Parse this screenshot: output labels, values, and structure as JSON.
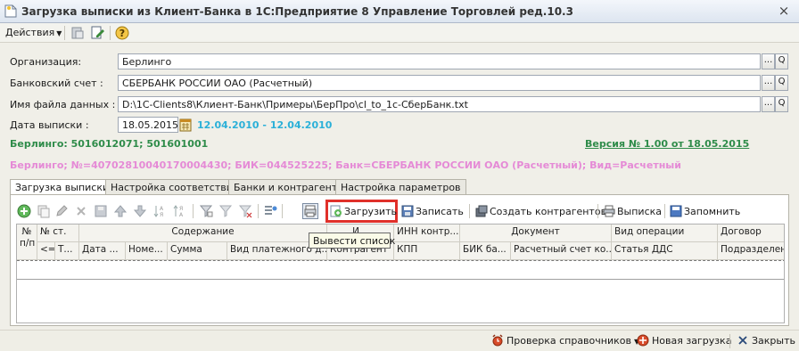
{
  "window": {
    "title": "Загрузка выписки из Клиент-Банка в 1С:Предприятие 8 Управление Торговлей ред.10.3",
    "close": "×"
  },
  "toolbar": {
    "actions_label": "Действия",
    "help_label": "?"
  },
  "form": {
    "org_label": "Организация:",
    "org_value": "Берлинго",
    "account_label": "Банковский счет :",
    "account_value": "СБЕРБАНК РОССИИ ОАО (Расчетный)",
    "file_label": "Имя файла данных :",
    "file_value": "D:\\1С-Clients8\\Клиент-Банк\\Примеры\\БерПро\\cl_to_1c-СберБанк.txt",
    "date_label": "Дата выписки :",
    "date_value": "18.05.2015",
    "period": "12.04.2010 - 12.04.2010",
    "org_codes": "Берлинго: 5016012071; 501601001",
    "version": "Версия № 1.00 от 18.05.2015",
    "bank_info": "Берлинго; №=40702810040170004430; БИК=044525225; Банк=СБЕРБАНК РОССИИ ОАО (Расчетный); Вид=Расчетный",
    "select_btn": "...",
    "search_btn": "Q"
  },
  "tabs": [
    {
      "label": "Загрузка выписки"
    },
    {
      "label": "Настройка соответствий"
    },
    {
      "label": "Банки и контрагенты"
    },
    {
      "label": "Настройка параметров"
    }
  ],
  "grid_toolbar": {
    "load": "Загрузить",
    "save": "Записать",
    "create_contractors": "Создать контрагентов",
    "statement": "Выписка",
    "remember": "Запомнить",
    "tooltip": "Вывести список"
  },
  "grid": {
    "header_row1": {
      "num": "№",
      "num2": "п/п",
      "st": "№ ст.",
      "content": "Содержание",
      "i": "И...",
      "inn": "ИНН контр...",
      "doc": "Документ",
      "op_type": "Вид операции",
      "contract": "Договор"
    },
    "header_row2": {
      "le": "<=",
      "t": "Т...",
      "date": "Дата ...",
      "number": "Номе...",
      "sum": "Сумма",
      "pay_type": "Вид платежного д...",
      "contractor": "Контрагент",
      "kpp": "КПП",
      "bik": "БИК ба...",
      "account": "Расчетный счет ко...",
      "dds": "Статья ДДС",
      "division": "Подразделен..."
    }
  },
  "bottom": {
    "check_refs": "Проверка справочников",
    "new_load": "Новая загрузка",
    "close": "Закрыть"
  },
  "colors": {
    "green_text": "#2f8c4a",
    "cyan_text": "#2bb0d8",
    "pink_text": "#e58ad6",
    "highlight": "#e0302a"
  }
}
